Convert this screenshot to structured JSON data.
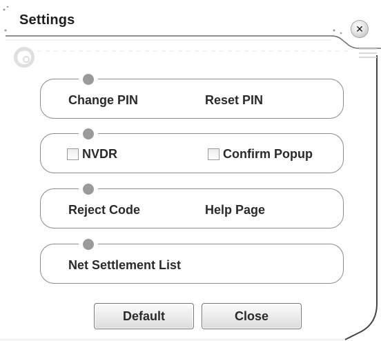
{
  "window": {
    "title": "Settings"
  },
  "icons": {
    "close": "close-icon",
    "menu": "menu-lines-icon",
    "logo": "app-logo-icon"
  },
  "groups": [
    {
      "items": [
        "Change PIN",
        "Reset PIN"
      ]
    },
    {
      "checkboxes": [
        {
          "label": "NVDR",
          "checked": false
        },
        {
          "label": "Confirm Popup",
          "checked": false
        }
      ]
    },
    {
      "items": [
        "Reject Code",
        "Help Page"
      ]
    },
    {
      "items": [
        "Net Settlement List"
      ]
    }
  ],
  "buttons": {
    "default_label": "Default",
    "close_label": "Close"
  },
  "colors": {
    "border": "#8a8a8a",
    "dot": "#9a9a9a",
    "text": "#2a2a2a"
  }
}
